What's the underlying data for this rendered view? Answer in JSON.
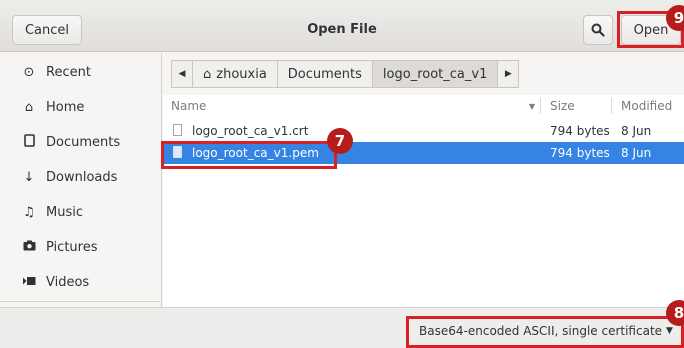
{
  "header": {
    "cancel_label": "Cancel",
    "title": "Open File",
    "search_icon": "search-icon",
    "open_label": "Open"
  },
  "sidebar": {
    "items": [
      {
        "label": "Recent",
        "icon": "clock-icon"
      },
      {
        "label": "Home",
        "icon": "home-icon"
      },
      {
        "label": "Documents",
        "icon": "document-icon"
      },
      {
        "label": "Downloads",
        "icon": "download-icon"
      },
      {
        "label": "Music",
        "icon": "music-icon"
      },
      {
        "label": "Pictures",
        "icon": "camera-icon"
      },
      {
        "label": "Videos",
        "icon": "video-icon"
      }
    ]
  },
  "pathbar": {
    "crumbs": [
      "zhouxia",
      "Documents",
      "logo_root_ca_v1"
    ]
  },
  "file_list": {
    "columns": {
      "name": "Name",
      "size": "Size",
      "modified": "Modified"
    },
    "rows": [
      {
        "name": "logo_root_ca_v1.crt",
        "size": "794 bytes",
        "modified": "8 Jun",
        "selected": false
      },
      {
        "name": "logo_root_ca_v1.pem",
        "size": "794 bytes",
        "modified": "8 Jun",
        "selected": true
      }
    ]
  },
  "footer": {
    "filter_selected": "Base64-encoded ASCII, single certificate"
  },
  "annotations": [
    "9",
    "7",
    "8"
  ],
  "colors": {
    "selection": "#3584e4",
    "highlight_box": "#d62226",
    "badge": "#b71c1c"
  }
}
